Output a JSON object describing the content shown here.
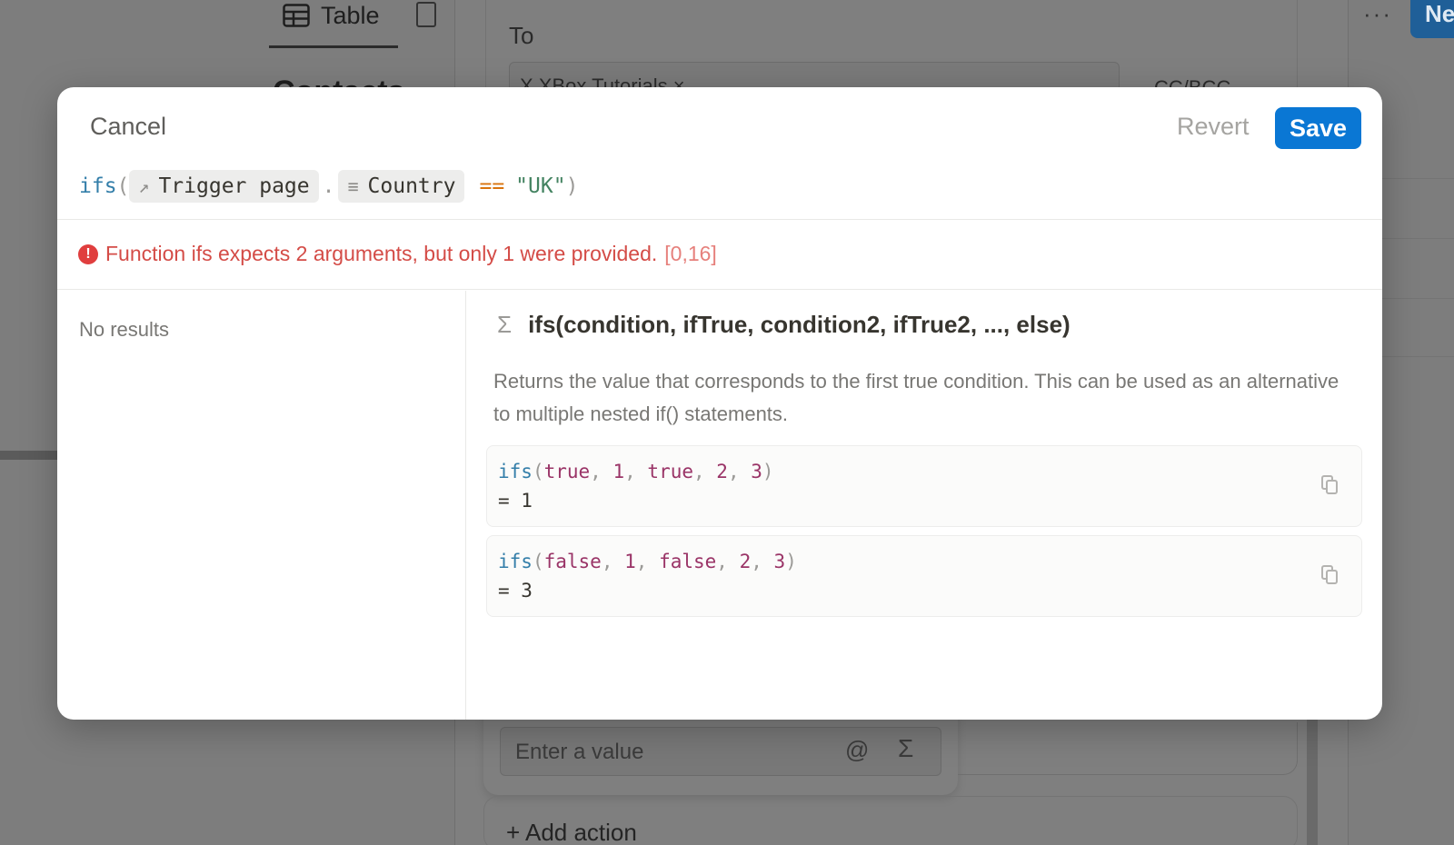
{
  "background": {
    "view_tab_label": "Table",
    "page_heading_peek": "Contacts",
    "more_label": "···",
    "new_button_label": "Ne",
    "to_label": "To",
    "to_tag": "X  XBox Tutorials  ×",
    "cc_bcc_label": "CC/BCC",
    "value_placeholder": "Enter a value",
    "at_symbol": "@",
    "sigma_symbol": "Σ",
    "add_action_label": "+ Add action"
  },
  "modal": {
    "cancel_label": "Cancel",
    "revert_label": "Revert",
    "save_label": "Save",
    "formula": {
      "function": "ifs",
      "open_paren": "(",
      "chip1_icon": "↗",
      "chip1_label": "Trigger page",
      "dot": ".",
      "chip2_icon": "≡",
      "chip2_label": "Country",
      "operator": "==",
      "string_value": "\"UK\"",
      "close_paren": ")"
    },
    "error": {
      "icon": "!",
      "message": "Function ifs expects 2 arguments, but only 1 were provided.",
      "range": "[0,16]"
    },
    "no_results": "No results",
    "doc": {
      "sigma": "Σ",
      "signature": "ifs(condition, ifTrue, condition2, ifTrue2, ..., else)",
      "description": "Returns the value that corresponds to the first true condition. This can be used as an alternative to multiple nested if() statements."
    },
    "examples": [
      {
        "fn": "ifs",
        "a1": "true",
        "a2": "1",
        "a3": "true",
        "a4": "2",
        "a5": "3",
        "result": "= 1"
      },
      {
        "fn": "ifs",
        "a1": "false",
        "a2": "1",
        "a3": "false",
        "a4": "2",
        "a5": "3",
        "result": "= 3"
      }
    ]
  },
  "colors": {
    "save_button": "#0a77d4",
    "error": "#d44c47",
    "function_name": "#337ea9",
    "string_literal": "#448361",
    "operator": "#d9730d",
    "keyword": "#9a3467"
  }
}
